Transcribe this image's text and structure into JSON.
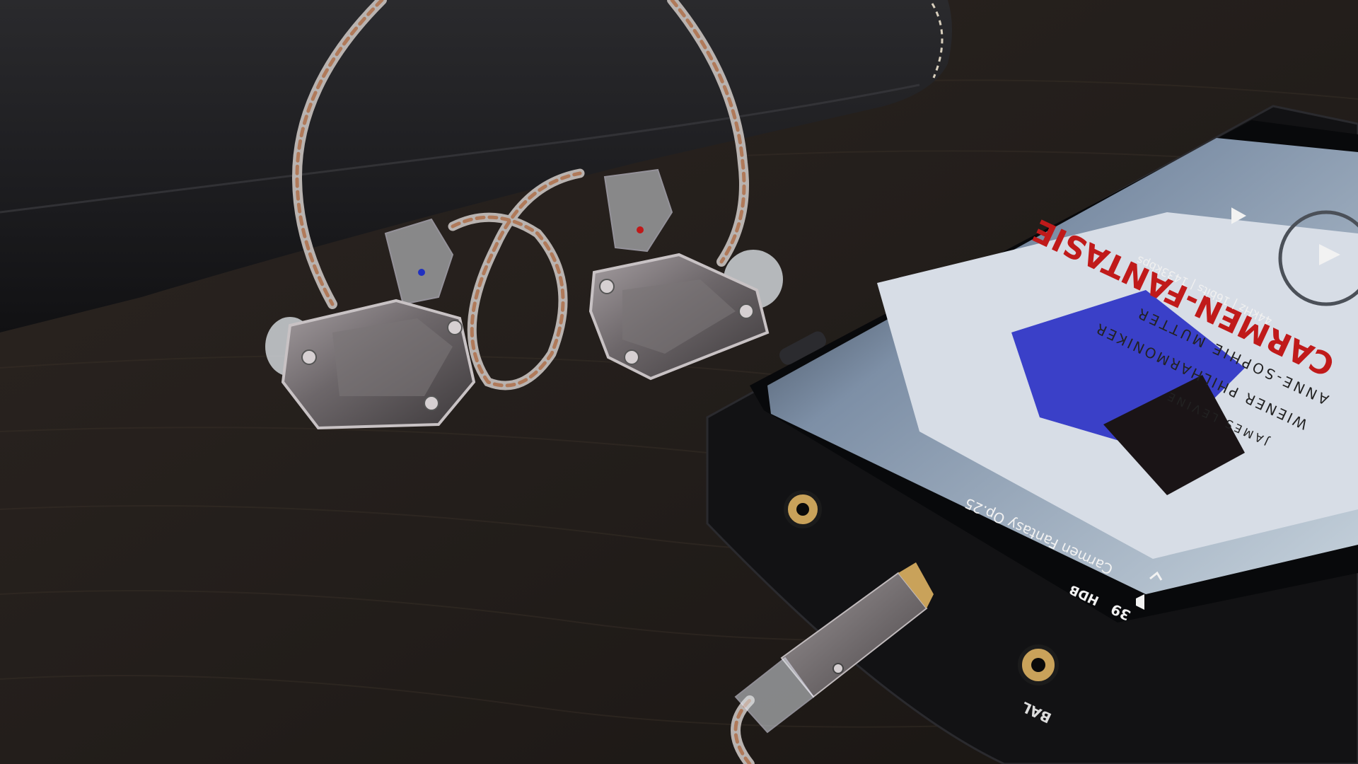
{
  "photo": {
    "colors": {
      "table": "#2a2420",
      "table_dark": "#1b1714",
      "case_leather": "#1c1c1e",
      "player_body": "#141416",
      "screen_bg": "#cfd8e0",
      "cover_blue": "#3a40c8",
      "cover_red": "#c01a1a",
      "shell_metal": "#8b8487",
      "cable_copper": "#b07a5a",
      "gold": "#c9a25a"
    },
    "player": {
      "jack_label_bal": "BAL",
      "status_bar": {
        "volume": "39",
        "gain": "HDB",
        "volume_icon": "speaker-icon",
        "back_icon": "chevron-up-icon"
      },
      "track": {
        "title": "Carmen Fantasy Op.25",
        "format_line": "44kHz | 16bits | 1433kbps"
      },
      "album_cover": {
        "title": "CARMEN-FANTASIE",
        "artist": "ANNE-SOPHIE MUTTER",
        "orchestra": "WIENER PHILHARMONIKER",
        "conductor": "JAMES LEVINE"
      },
      "controls": {
        "play_icon": "play-icon",
        "prev_icon": "previous-icon"
      }
    }
  }
}
